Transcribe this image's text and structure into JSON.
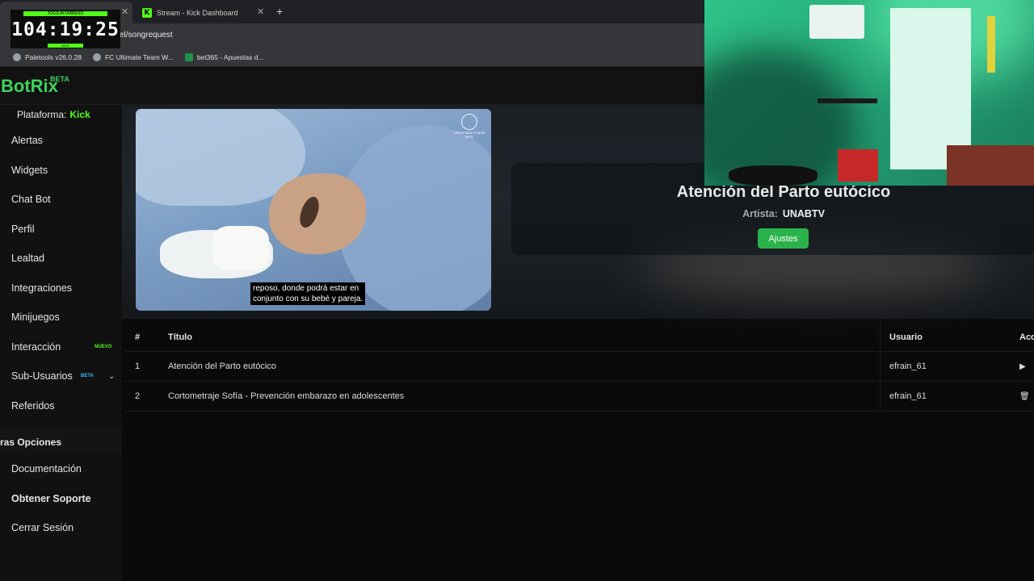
{
  "browser": {
    "tabs": [
      {
        "title": "",
        "active": true
      },
      {
        "title": "Stream - Kick Dashboard",
        "active": false
      }
    ],
    "url": "el/songrequest",
    "bookmarks": [
      {
        "label": "Paletools v26.0.28",
        "icon": "globe-icon"
      },
      {
        "label": "FC Ultimate Team W...",
        "icon": "globe-icon"
      },
      {
        "label": "bet365 - Apuestas d...",
        "icon": "bet365-icon"
      }
    ]
  },
  "timer": {
    "value": "104:19:25",
    "top_label": "JOGSUN7ARBENO",
    "bottom_label": "KICK"
  },
  "app": {
    "name": "BotRix",
    "badge": "BETA"
  },
  "sidebar": {
    "platform_label": "Plataforma:",
    "platform_value": "Kick",
    "items": [
      {
        "label": "Alertas"
      },
      {
        "label": "Widgets"
      },
      {
        "label": "Chat Bot"
      },
      {
        "label": "Perfil"
      },
      {
        "label": "Lealtad"
      },
      {
        "label": "Integraciones"
      },
      {
        "label": "Minijuegos"
      },
      {
        "label": "Interacción",
        "badge": "NUEVO"
      },
      {
        "label": "Sub-Usuarios",
        "badge": "BETA"
      },
      {
        "label": "Referidos"
      }
    ],
    "section_title": "ras Opciones",
    "other_items": [
      {
        "label": "Documentación"
      },
      {
        "label": "Obtener Soporte"
      },
      {
        "label": "Cerrar Sesión"
      }
    ]
  },
  "player": {
    "subtitle": "reposo, donde podrá  estar en\nconjunto con su bebé y pareja.",
    "watermark": "Universidad Andrés Bello",
    "song_title": "Atención del Parto eutócico",
    "artist_label": "Artista:",
    "artist_value": "UNABTV",
    "settings_button": "Ajustes"
  },
  "queue": {
    "headers": {
      "num": "#",
      "title": "Título",
      "user": "Usuario",
      "actions": "Acc"
    },
    "rows": [
      {
        "num": "1",
        "title": "Atención del Parto eutócico",
        "user": "efrain_61",
        "action_icon": "play-icon"
      },
      {
        "num": "2",
        "title": "Cortometraje Sofía - Prevención embarazo en adolescentes",
        "user": "efrain_61",
        "action_icon": "trash-icon"
      }
    ]
  },
  "colors": {
    "accent": "#53fc18",
    "brand": "#3fd25c",
    "button": "#2bb34b"
  }
}
